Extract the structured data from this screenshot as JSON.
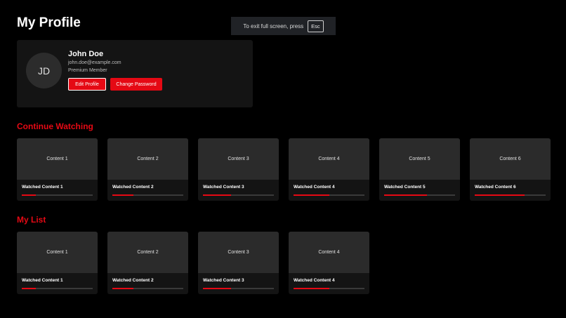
{
  "page": {
    "title": "My Profile"
  },
  "fullscreen_notice": {
    "text": "To exit full screen, press",
    "key": "Esc"
  },
  "profile": {
    "initials": "JD",
    "name": "John Doe",
    "email": "john.doe@example.com",
    "membership": "Premium Member",
    "edit_label": "Edit Profile",
    "password_label": "Change Password"
  },
  "continue_watching": {
    "title": "Continue Watching",
    "items": [
      {
        "thumb": "Content 1",
        "title": "Watched Content 1",
        "progress": 0.2
      },
      {
        "thumb": "Content 2",
        "title": "Watched Content 2",
        "progress": 0.3
      },
      {
        "thumb": "Content 3",
        "title": "Watched Content 3",
        "progress": 0.4
      },
      {
        "thumb": "Content 4",
        "title": "Watched Content 4",
        "progress": 0.5
      },
      {
        "thumb": "Content 5",
        "title": "Watched Content 5",
        "progress": 0.6
      },
      {
        "thumb": "Content 6",
        "title": "Watched Content 6",
        "progress": 0.7
      }
    ]
  },
  "my_list": {
    "title": "My List",
    "items": [
      {
        "thumb": "Content 1",
        "title": "Watched Content 1",
        "progress": 0.2
      },
      {
        "thumb": "Content 2",
        "title": "Watched Content 2",
        "progress": 0.3
      },
      {
        "thumb": "Content 3",
        "title": "Watched Content 3",
        "progress": 0.4
      },
      {
        "thumb": "Content 4",
        "title": "Watched Content 4",
        "progress": 0.5
      }
    ]
  },
  "colors": {
    "accent": "#e50914",
    "background": "#000000",
    "card": "#141414",
    "thumb": "#2b2b2b"
  }
}
